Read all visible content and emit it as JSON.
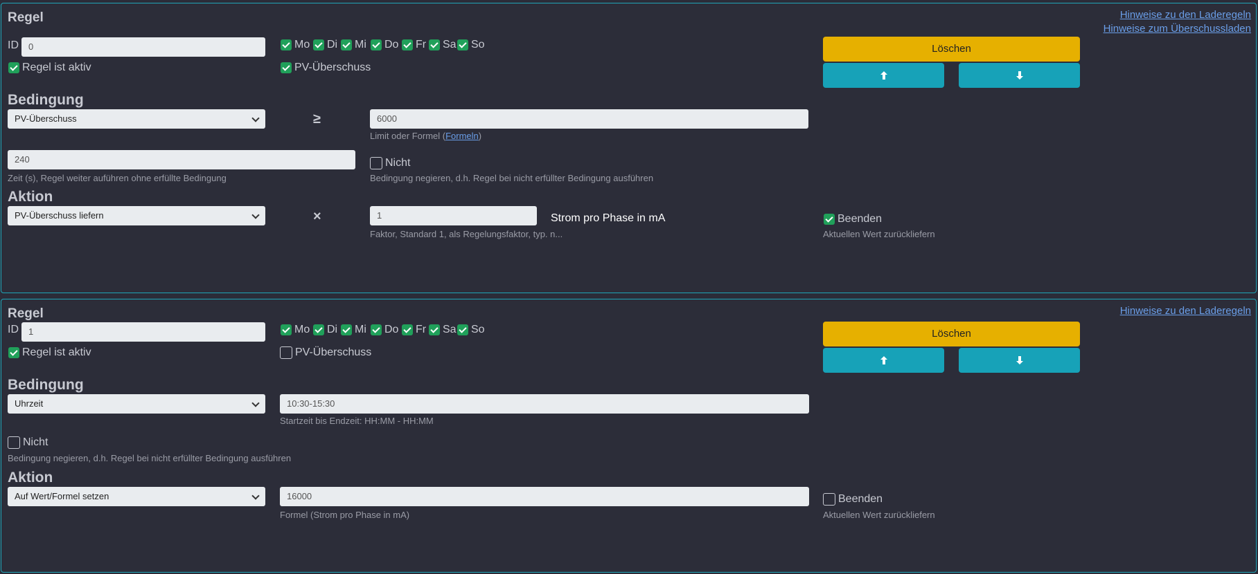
{
  "rules": [
    {
      "title": "Regel",
      "links": [
        "Hinweise zu den Laderegeln",
        "Hinweise zum Überschussladen"
      ],
      "id_label": "ID",
      "id_value": "0",
      "days": [
        {
          "label": "Mo",
          "checked": true
        },
        {
          "label": "Di",
          "checked": true
        },
        {
          "label": "Mi",
          "checked": true
        },
        {
          "label": "Do",
          "checked": true
        },
        {
          "label": "Fr",
          "checked": true
        },
        {
          "label": "Sa",
          "checked": true
        },
        {
          "label": "So",
          "checked": true
        }
      ],
      "active_label": "Regel ist aktiv",
      "active_checked": true,
      "pv_label": "PV-Überschuss",
      "pv_checked": true,
      "delete_label": "Löschen",
      "condition_heading": "Bedingung",
      "condition_select": "PV-Überschuss",
      "operator": "≥",
      "limit_value": "6000",
      "limit_help_prefix": "Limit oder Formel (",
      "limit_help_link": "Formeln",
      "limit_help_suffix": ")",
      "time_value": "240",
      "time_help": "Zeit (s), Regel weiter auführen ohne erfüllte Bedingung",
      "not_label": "Nicht",
      "not_checked": false,
      "not_help": "Bedingung negieren, d.h. Regel bei nicht erfüllter Bedingung ausführen",
      "action_heading": "Aktion",
      "action_select": "PV-Überschuss liefern",
      "action_operator": "×",
      "factor_value": "1",
      "factor_help": "Faktor, Standard 1, als Regelungsfaktor, typ. n...",
      "unit_label": "Strom pro Phase in mA",
      "end_label": "Beenden",
      "end_checked": true,
      "end_help": "Aktuellen Wert zurückliefern"
    },
    {
      "title": "Regel",
      "links": [
        "Hinweise zu den Laderegeln"
      ],
      "id_label": "ID",
      "id_value": "1",
      "days": [
        {
          "label": "Mo",
          "checked": true
        },
        {
          "label": "Di",
          "checked": true
        },
        {
          "label": "Mi",
          "checked": true
        },
        {
          "label": "Do",
          "checked": true
        },
        {
          "label": "Fr",
          "checked": true
        },
        {
          "label": "Sa",
          "checked": true
        },
        {
          "label": "So",
          "checked": true
        }
      ],
      "active_label": "Regel ist aktiv",
      "active_checked": true,
      "pv_label": "PV-Überschuss",
      "pv_checked": false,
      "delete_label": "Löschen",
      "condition_heading": "Bedingung",
      "condition_select": "Uhrzeit",
      "time_range_value": "10:30-15:30",
      "time_range_help": "Startzeit bis Endzeit: HH:MM - HH:MM",
      "not_label": "Nicht",
      "not_checked": false,
      "not_help": "Bedingung negieren, d.h. Regel bei nicht erfüllter Bedingung ausführen",
      "action_heading": "Aktion",
      "action_select": "Auf Wert/Formel setzen",
      "formula_value": "16000",
      "formula_help": "Formel (Strom pro Phase in mA)",
      "end_label": "Beenden",
      "end_checked": false,
      "end_help": "Aktuellen Wert zurückliefern"
    }
  ],
  "colors": {
    "background": "#2b2c38",
    "border": "#1fa6b8",
    "delete_button": "#e6b000",
    "move_button": "#17a2b8",
    "checkbox_checked": "#20a05a",
    "link": "#6a9ee8"
  },
  "icons": {
    "move_up": "arrow-up-icon",
    "move_down": "arrow-down-icon",
    "select": "chevron-down-icon"
  }
}
